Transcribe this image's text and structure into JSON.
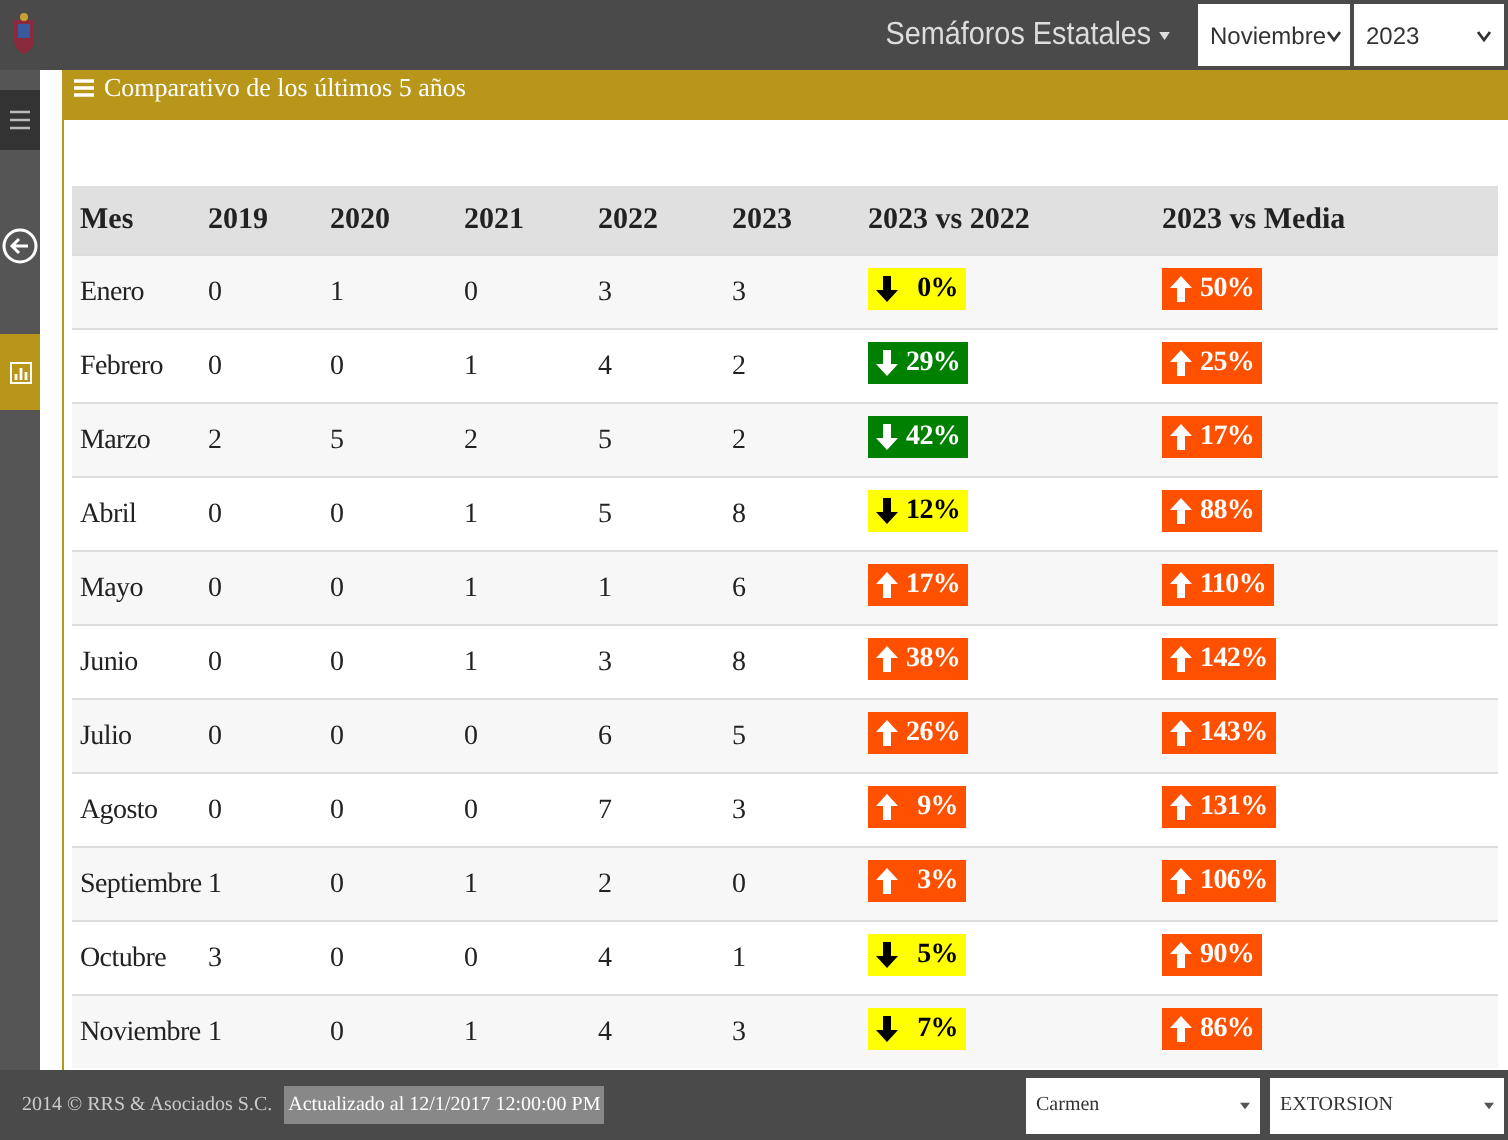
{
  "topbar": {
    "menu": "Semáforos Estatales",
    "month": "Noviembre",
    "year": "2023"
  },
  "panel": {
    "title": "Comparativo de los últimos 5 años"
  },
  "sidebar": {
    "items": [
      {
        "kind": "menu",
        "selected": false
      },
      {
        "kind": "back",
        "selected": false
      },
      {
        "kind": "chart",
        "selected": true
      }
    ]
  },
  "table": {
    "columns": [
      "Mes",
      "2019",
      "2020",
      "2021",
      "2022",
      "2023",
      "2023 vs 2022",
      "2023 vs Media"
    ],
    "rows": [
      {
        "cells": [
          "Enero",
          "0",
          "1",
          "0",
          "3",
          "3"
        ],
        "badges": [
          {
            "text": "0%",
            "kind": "down",
            "color": "#ffff00"
          },
          {
            "text": "50%",
            "kind": "up",
            "color": "#ff5000"
          }
        ]
      },
      {
        "cells": [
          "Febrero",
          "0",
          "0",
          "1",
          "4",
          "2"
        ],
        "badges": [
          {
            "text": "29%",
            "kind": "down",
            "color": "#008000"
          },
          {
            "text": "25%",
            "kind": "up",
            "color": "#ff5000"
          }
        ]
      },
      {
        "cells": [
          "Marzo",
          "2",
          "5",
          "2",
          "5",
          "2"
        ],
        "badges": [
          {
            "text": "42%",
            "kind": "down",
            "color": "#008000"
          },
          {
            "text": "17%",
            "kind": "up",
            "color": "#ff5000"
          }
        ]
      },
      {
        "cells": [
          "Abril",
          "0",
          "0",
          "1",
          "5",
          "8"
        ],
        "badges": [
          {
            "text": "12%",
            "kind": "down",
            "color": "#ffff00"
          },
          {
            "text": "88%",
            "kind": "up",
            "color": "#ff5000"
          }
        ]
      },
      {
        "cells": [
          "Mayo",
          "0",
          "0",
          "1",
          "1",
          "6"
        ],
        "badges": [
          {
            "text": "17%",
            "kind": "up",
            "color": "#ff5000"
          },
          {
            "text": "110%",
            "kind": "up",
            "color": "#ff5000"
          }
        ]
      },
      {
        "cells": [
          "Junio",
          "0",
          "0",
          "1",
          "3",
          "8"
        ],
        "badges": [
          {
            "text": "38%",
            "kind": "up",
            "color": "#ff5000"
          },
          {
            "text": "142%",
            "kind": "up",
            "color": "#ff5000"
          }
        ]
      },
      {
        "cells": [
          "Julio",
          "0",
          "0",
          "0",
          "6",
          "5"
        ],
        "badges": [
          {
            "text": "26%",
            "kind": "up",
            "color": "#ff5000"
          },
          {
            "text": "143%",
            "kind": "up",
            "color": "#ff5000"
          }
        ]
      },
      {
        "cells": [
          "Agosto",
          "0",
          "0",
          "0",
          "7",
          "3"
        ],
        "badges": [
          {
            "text": "9%",
            "kind": "up",
            "color": "#ff5000"
          },
          {
            "text": "131%",
            "kind": "up",
            "color": "#ff5000"
          }
        ]
      },
      {
        "cells": [
          "Septiembre",
          "1",
          "0",
          "1",
          "2",
          "0"
        ],
        "badges": [
          {
            "text": "3%",
            "kind": "up",
            "color": "#ff5000"
          },
          {
            "text": "106%",
            "kind": "up",
            "color": "#ff5000"
          }
        ]
      },
      {
        "cells": [
          "Octubre",
          "3",
          "0",
          "0",
          "4",
          "1"
        ],
        "badges": [
          {
            "text": "5%",
            "kind": "down",
            "color": "#ffff00"
          },
          {
            "text": "90%",
            "kind": "up",
            "color": "#ff5000"
          }
        ]
      },
      {
        "cells": [
          "Noviembre",
          "1",
          "0",
          "1",
          "4",
          "3"
        ],
        "badges": [
          {
            "text": "7%",
            "kind": "down",
            "color": "#ffff00"
          },
          {
            "text": "86%",
            "kind": "up",
            "color": "#ff5000"
          }
        ]
      }
    ]
  },
  "footer": {
    "copyright": "2014 © RRS & Asociados S.C.",
    "updated": "Actualizado al 12/1/2017 12:00:00 PM",
    "selects": [
      "Carmen",
      "EXTORSION"
    ]
  }
}
